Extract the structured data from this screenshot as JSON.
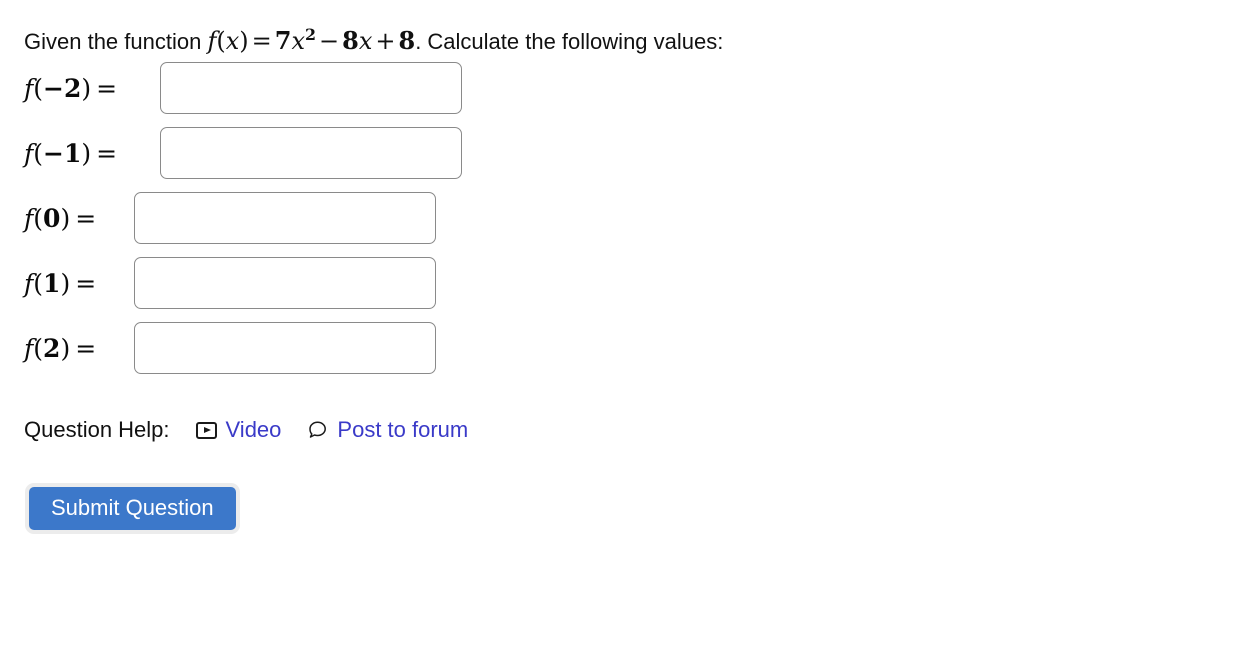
{
  "problem": {
    "intro_before_math": "Given the function ",
    "function_parts": {
      "f": "f",
      "open": "(",
      "var": "x",
      "close": ")",
      "equals": "=",
      "coefficient": "7",
      "squared_var": "x",
      "exponent": "2",
      "minus": "−",
      "linear_coefficient": "8",
      "linear_var": "x",
      "plus": "+",
      "constant": "8"
    },
    "function_plain": "f(x) = 7x² − 8x + 8",
    "intro_after_math": ". Calculate the following values:"
  },
  "answers": [
    {
      "label_f": "f",
      "label_open": "(",
      "label_arg": "−2",
      "label_close": ")",
      "label_eq": "=",
      "label_plain": "f(−2) =",
      "value": "",
      "placeholder": ""
    },
    {
      "label_f": "f",
      "label_open": "(",
      "label_arg": "−1",
      "label_close": ")",
      "label_eq": "=",
      "label_plain": "f(−1) =",
      "value": "",
      "placeholder": ""
    },
    {
      "label_f": "f",
      "label_open": "(",
      "label_arg": "0",
      "label_close": ")",
      "label_eq": "=",
      "label_plain": "f(0) =",
      "value": "",
      "placeholder": ""
    },
    {
      "label_f": "f",
      "label_open": "(",
      "label_arg": "1",
      "label_close": ")",
      "label_eq": "=",
      "label_plain": "f(1) =",
      "value": "",
      "placeholder": ""
    },
    {
      "label_f": "f",
      "label_open": "(",
      "label_arg": "2",
      "label_close": ")",
      "label_eq": "=",
      "label_plain": "f(2) =",
      "value": "",
      "placeholder": ""
    }
  ],
  "help": {
    "label": "Question Help:",
    "links": [
      {
        "icon": "video-icon",
        "label": "Video"
      },
      {
        "icon": "speech-bubble-icon",
        "label": "Post to forum"
      }
    ]
  },
  "submit": {
    "label": "Submit Question"
  },
  "colors": {
    "link": "#3a3ac8",
    "button_background": "#3c78ca",
    "button_text": "#ffffff",
    "input_border": "#8a8a8a",
    "text": "#111111",
    "page_background": "#ffffff"
  }
}
